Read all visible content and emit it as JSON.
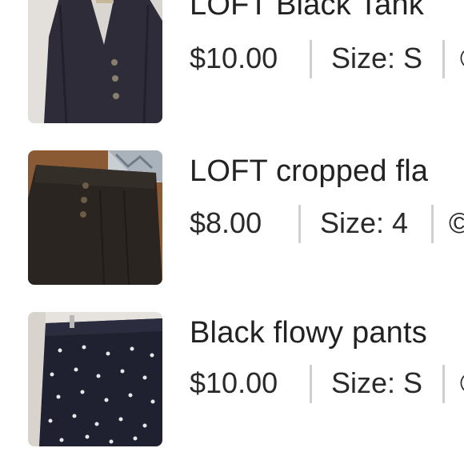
{
  "listings": [
    {
      "title": "LOFT Black Tank",
      "price": "$10.00",
      "size": "Size: S",
      "thumbnail_icon": "black-button-tank-photo"
    },
    {
      "title": "LOFT cropped fla",
      "price": "$8.00",
      "size": "Size: 4",
      "thumbnail_icon": "black-cropped-pants-photo"
    },
    {
      "title": "Black flowy pants",
      "price": "$10.00",
      "size": "Size: S",
      "thumbnail_icon": "polka-dot-pants-photo"
    }
  ],
  "colors": {
    "text": "#222222",
    "divider": "#cfcfcf",
    "background": "#ffffff"
  }
}
